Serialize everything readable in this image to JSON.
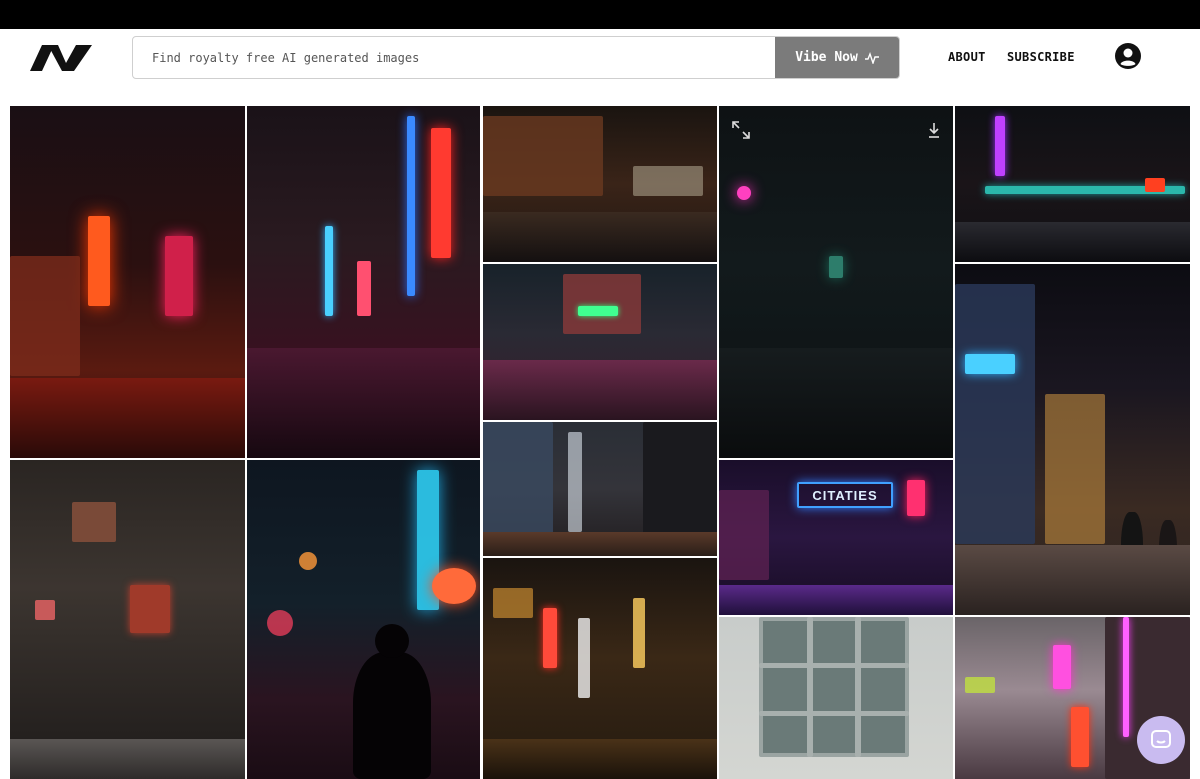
{
  "header": {
    "search": {
      "placeholder": "Find royalty free AI generated images",
      "value": ""
    },
    "search_button_label": "Vibe Now",
    "nav": {
      "about": "ABOUT",
      "subscribe": "SUBSCRIBE"
    }
  },
  "gallery": {
    "tiles": [
      {
        "id": "neon-storefront-red"
      },
      {
        "id": "neon-street-signs"
      },
      {
        "id": "city-intersection-night"
      },
      {
        "id": "dark-foggy-street"
      },
      {
        "id": "blue-traffic-street"
      },
      {
        "id": "cyclist-rain-reflection"
      },
      {
        "id": "tall-city-street-night"
      },
      {
        "id": "dark-alley-signs"
      },
      {
        "id": "silhouette-bokeh-neon"
      },
      {
        "id": "narrow-alley-lights"
      },
      {
        "id": "citaties-neon-street"
      },
      {
        "id": "asian-market-street"
      },
      {
        "id": "building-window-facade"
      },
      {
        "id": "pink-neon-street"
      }
    ],
    "neon_sign_text": "CITATIES",
    "hover_actions": {
      "expand": "expand-icon",
      "download": "download-icon"
    }
  },
  "colors": {
    "accent_button": "#7b7b7b",
    "chat_bubble": "#c9bbf0"
  }
}
